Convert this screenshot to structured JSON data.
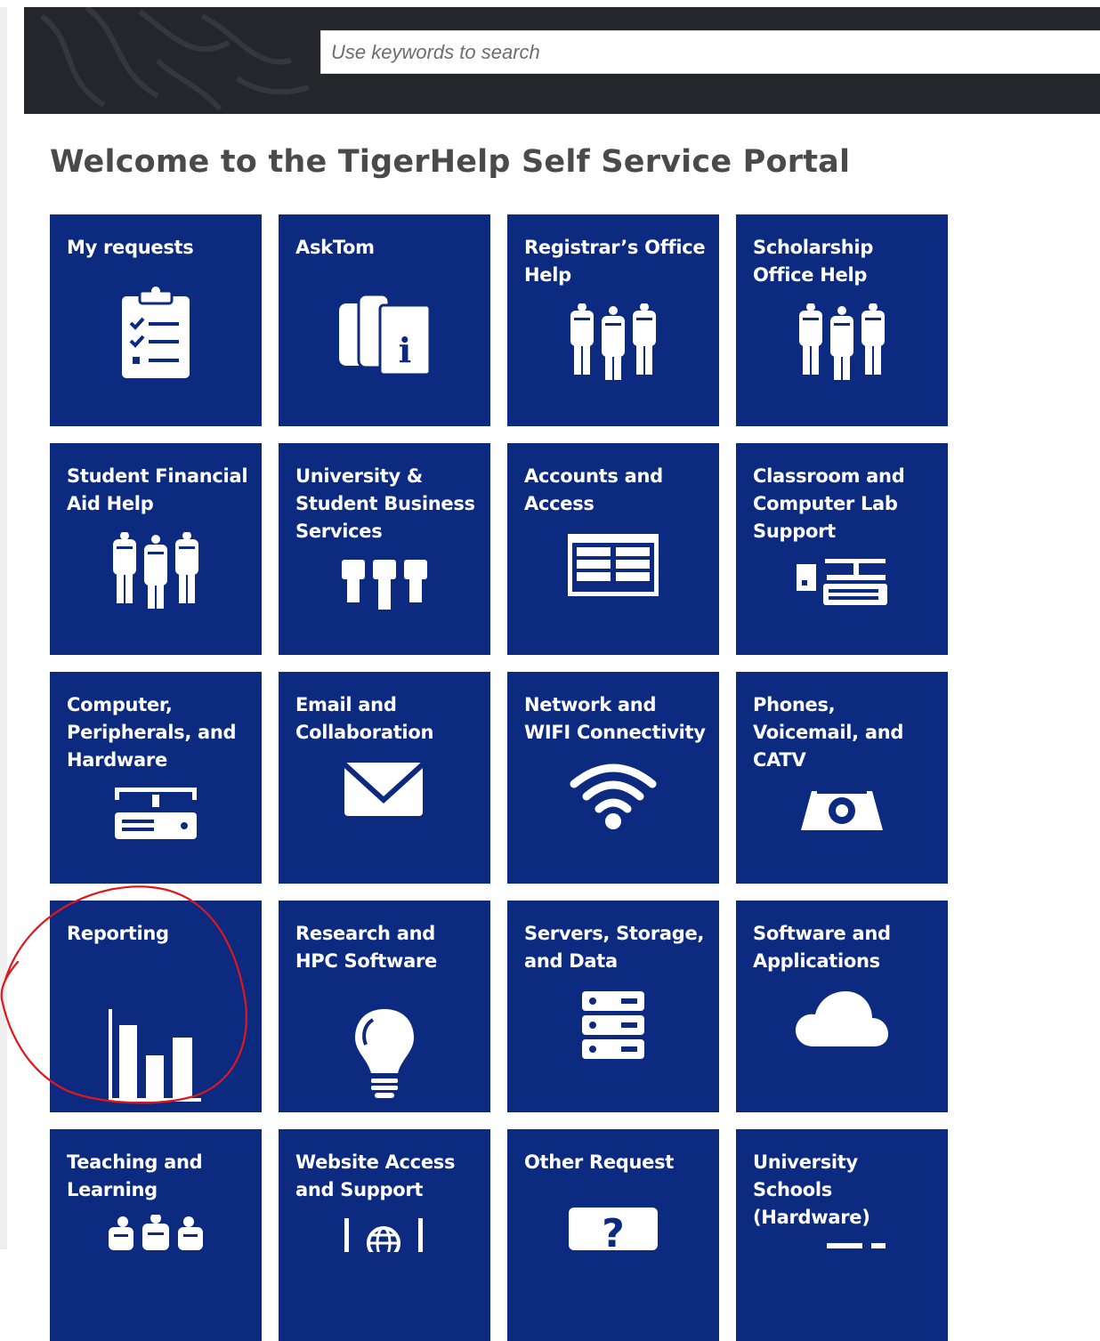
{
  "search": {
    "placeholder": "Use keywords to search"
  },
  "page": {
    "title": "Welcome to the TigerHelp Self Service Portal"
  },
  "colors": {
    "tile": "#0c2a80",
    "banner": "#24262b",
    "title": "#4a4a4a",
    "annotation": "#e0161b"
  },
  "tiles": [
    {
      "label": "My requests",
      "icon": "clipboard-checklist-icon"
    },
    {
      "label": "AskTom",
      "icon": "books-info-icon"
    },
    {
      "label": "Registrar’s Office Help",
      "icon": "people-group-icon"
    },
    {
      "label": "Scholarship Office Help",
      "icon": "people-group-icon"
    },
    {
      "label": "Student Financial Aid Help",
      "icon": "people-group-icon"
    },
    {
      "label": "University & Student Business Services",
      "icon": "people-group-icon"
    },
    {
      "label": "Accounts and Access",
      "icon": "browser-window-icon"
    },
    {
      "label": "Classroom and Computer Lab Support",
      "icon": "computer-lab-icon"
    },
    {
      "label": "Computer, Peripherals, and Hardware",
      "icon": "hardware-icon"
    },
    {
      "label": "Email and Collaboration",
      "icon": "envelope-icon"
    },
    {
      "label": "Network and WIFI Connectivity",
      "icon": "wifi-icon"
    },
    {
      "label": "Phones, Voicemail, and CATV",
      "icon": "phone-icon"
    },
    {
      "label": "Reporting",
      "icon": "bar-chart-icon"
    },
    {
      "label": "Research and HPC Software",
      "icon": "lightbulb-icon"
    },
    {
      "label": "Servers, Storage, and Data",
      "icon": "server-stack-icon"
    },
    {
      "label": "Software and Applications",
      "icon": "cloud-icon"
    },
    {
      "label": "Teaching and Learning",
      "icon": "people-group-icon"
    },
    {
      "label": "Website Access and Support",
      "icon": "globe-icon"
    },
    {
      "label": "Other Request",
      "icon": "question-icon"
    },
    {
      "label": "University Schools (Hardware)",
      "icon": "hardware-icon"
    }
  ]
}
